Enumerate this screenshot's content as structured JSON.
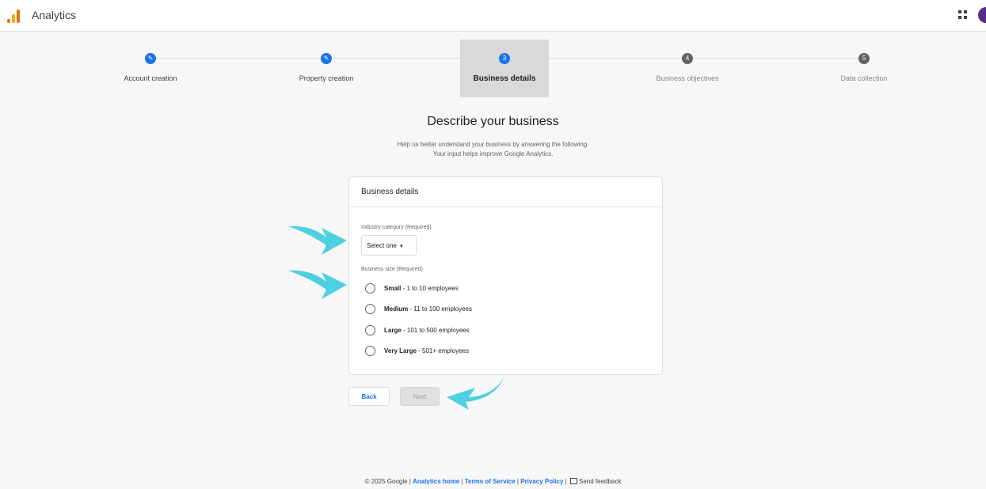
{
  "app": {
    "title": "Analytics"
  },
  "steps": [
    {
      "label": "Account creation",
      "state": "done",
      "marker": "✎"
    },
    {
      "label": "Property creation",
      "state": "done",
      "marker": "✎"
    },
    {
      "label": "Business details",
      "state": "current",
      "marker": "3"
    },
    {
      "label": "Business objectives",
      "state": "pending",
      "marker": "4"
    },
    {
      "label": "Data collection",
      "state": "pending",
      "marker": "5"
    }
  ],
  "page": {
    "heading": "Describe your business",
    "subtitle_line1": "Help us better understand your business by answering the following.",
    "subtitle_line2": "Your input helps improve Google Analytics."
  },
  "card": {
    "title": "Business details",
    "industry_label": "Industry category (Required)",
    "industry_value": "Select one",
    "size_label": "Business size (Required)",
    "sizes": [
      {
        "name": "Small",
        "detail": " - 1 to 10 employees"
      },
      {
        "name": "Medium",
        "detail": " - 11 to 100 employees"
      },
      {
        "name": "Large",
        "detail": " - 101 to 500 employees"
      },
      {
        "name": "Very Large",
        "detail": " - 501+ employees"
      }
    ]
  },
  "buttons": {
    "back": "Back",
    "next": "Next"
  },
  "footer": {
    "copyright": "© 2025 Google",
    "sep": " | ",
    "analytics_home": "Analytics home",
    "terms": "Terms of Service",
    "privacy": "Privacy Policy",
    "feedback": "Send feedback"
  },
  "colors": {
    "accent": "#1a73e8",
    "arrow": "#4dd0e1",
    "active_step_bg": "#d9d9d9"
  }
}
